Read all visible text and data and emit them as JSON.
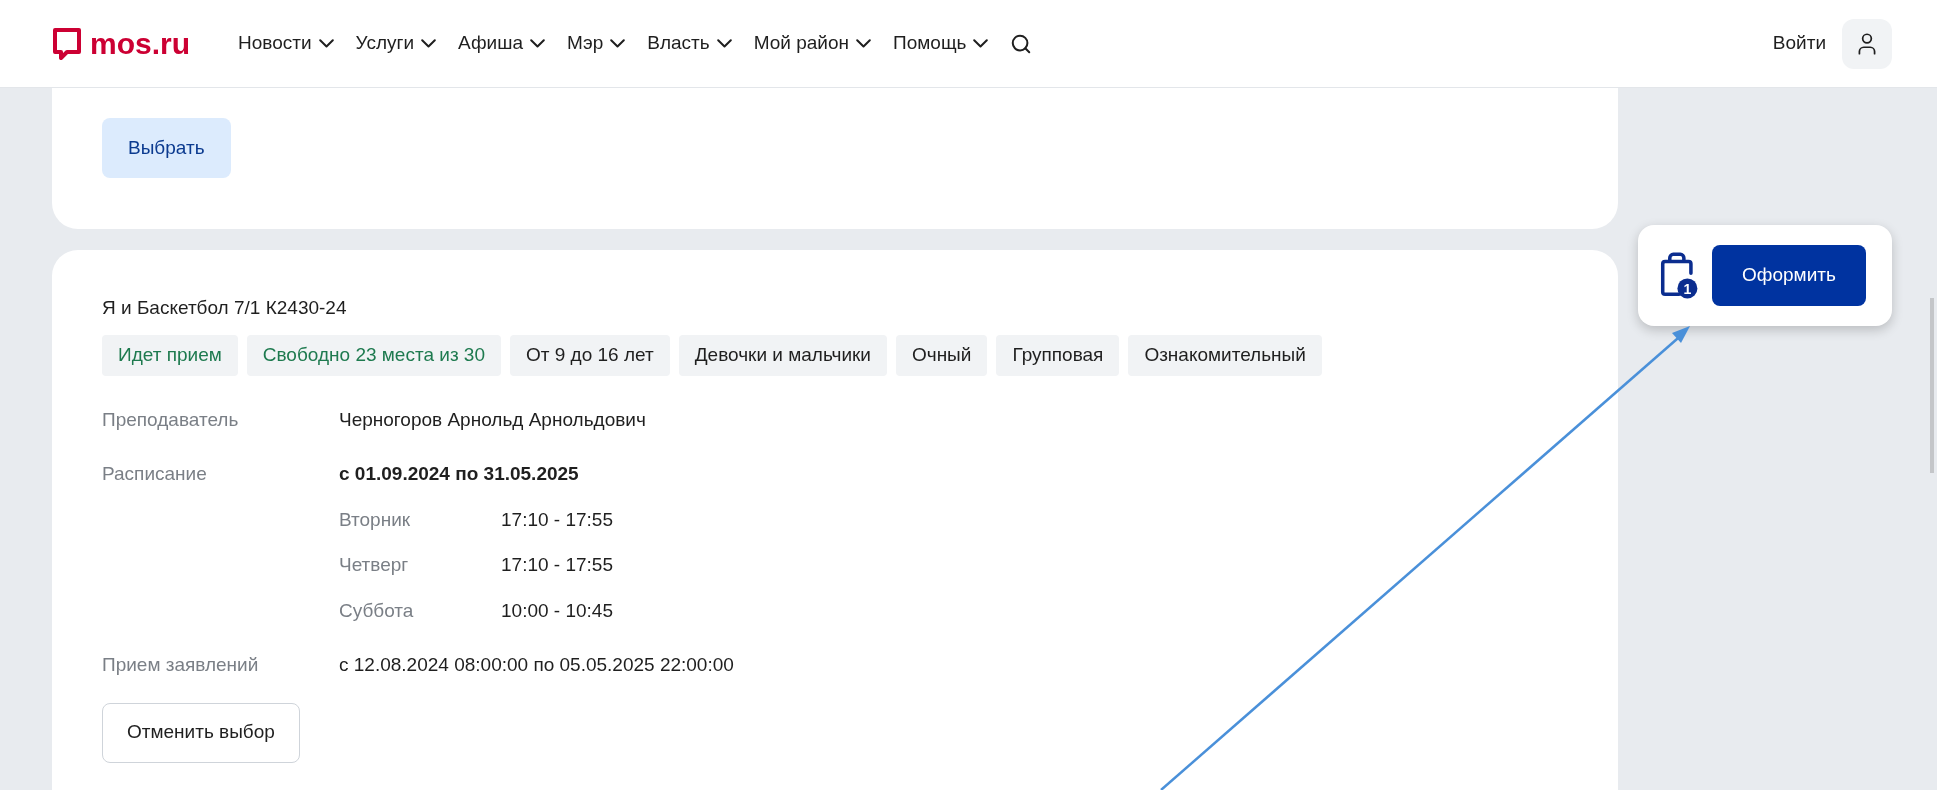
{
  "header": {
    "logo": "mos.ru",
    "nav": [
      {
        "label": "Новости"
      },
      {
        "label": "Услуги"
      },
      {
        "label": "Афиша"
      },
      {
        "label": "Мэр"
      },
      {
        "label": "Власть"
      },
      {
        "label": "Мой район"
      },
      {
        "label": "Помощь"
      }
    ],
    "login": "Войти"
  },
  "top_card": {
    "button": "Выбрать"
  },
  "course": {
    "title": "Я и Баскетбол 7/1 К2430-24",
    "tags": [
      {
        "label": "Идет прием",
        "kind": "status"
      },
      {
        "label": "Свободно 23 места из 30",
        "kind": "status"
      },
      {
        "label": "От 9 до 16 лет",
        "kind": "info"
      },
      {
        "label": "Девочки и мальчики",
        "kind": "info"
      },
      {
        "label": "Очный",
        "kind": "info"
      },
      {
        "label": "Групповая",
        "kind": "info"
      },
      {
        "label": "Ознакомительный",
        "kind": "info"
      }
    ],
    "teacher_label": "Преподаватель",
    "teacher": "Черногоров Арнольд Арнольдович",
    "schedule_label": "Расписание",
    "schedule_period": "с 01.09.2024 по 31.05.2025",
    "schedule": [
      {
        "day": "Вторник",
        "time": "17:10 - 17:55"
      },
      {
        "day": "Четверг",
        "time": "17:10 - 17:55"
      },
      {
        "day": "Суббота",
        "time": "10:00 - 10:45"
      }
    ],
    "applications_label": "Прием заявлений",
    "applications": "с 12.08.2024 08:00:00 по 05.05.2025 22:00:00",
    "cancel_button": "Отменить выбор"
  },
  "cart": {
    "count": "1",
    "button": "Оформить"
  }
}
